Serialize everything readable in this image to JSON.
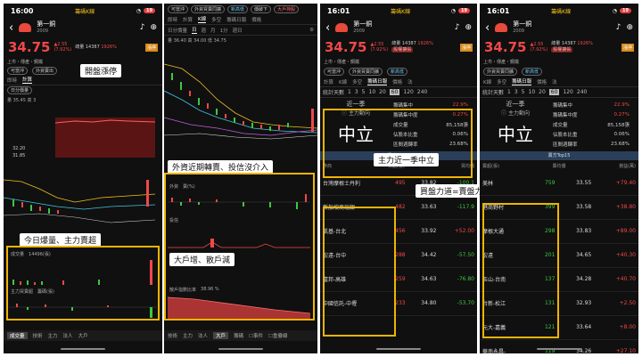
{
  "screen1": {
    "time": "16:00",
    "carrier": "籌碼K線",
    "battery": "19",
    "stock_name": "第一銅",
    "stock_code": "2009",
    "price": "34.75",
    "change": "▲2.55",
    "change_pct": "(7.92%)",
    "volume_text": "總量 14387",
    "vol_pct": "1926%",
    "limit_tag": "漲停",
    "market": "上市・傳產・鋼鐵",
    "tab_labels": [
      "可當沖",
      "外資賣出"
    ],
    "sub_tabs": [
      "即時",
      "計算"
    ],
    "day_label": "日分價量",
    "ma_text": "量 35.45 高 3",
    "price_marks": [
      "32.20",
      "31.85"
    ],
    "vol_legend": "成交量",
    "vol_value": "14496(張)",
    "main_legend": "主力買賣超",
    "main_unit": "籌碼(張)",
    "bottom_tabs": [
      "成交量",
      "技術",
      "主力",
      "法人",
      "大戶"
    ],
    "callout_a": "開盤漲停",
    "callout_b": "今日爆量、主力賣超"
  },
  "screen2": {
    "chips": [
      "可當沖",
      "外資買賣同擴",
      "新高低",
      "價破下",
      "大戶持股"
    ],
    "tabs": [
      "即時",
      "計算",
      "K線",
      "多空",
      "籌碼日報",
      "價格"
    ],
    "chart_header": [
      "日分價量",
      "日",
      "週",
      "月",
      "1分",
      "週日"
    ],
    "ma_line": "量 36.40 高 34.00 低 34.75",
    "legend_1": "外資",
    "legend_1b": "賣(%)",
    "legend_2": "投信",
    "legend_3": "散戶指數比率",
    "legend_3b": "38.96 %",
    "pct_marks": [
      "59.66%",
      "38.96%"
    ],
    "bottom_tabs": [
      "技術",
      "主力",
      "法人",
      "大戶",
      "籌碼"
    ],
    "bottom_on": "大戶",
    "checkbox_a": "事件",
    "checkbox_b": "重疊線",
    "callout_a": "外資近期轉賣、投信沒介入",
    "callout_b": "大戶增、散戶減"
  },
  "screen3": {
    "time": "16:01",
    "carrier": "籌碼K線",
    "battery": "19",
    "stock_name": "第一銅",
    "stock_code": "2009",
    "price": "34.75",
    "change": "▲2.55",
    "change_pct": "(7.92%)",
    "volume_text": "總量 14387",
    "vol_pct": "1926%",
    "tag": "股權擴張",
    "limit_tag": "漲停",
    "market": "上市・傳產・鋼鐵",
    "pills": [
      "可當沖",
      "外資買賣同擴",
      "新高低"
    ],
    "tabs": [
      "計算",
      "K線",
      "多空",
      "籌碼日報",
      "價格",
      "法"
    ],
    "days_label": "統計天數",
    "days": [
      "1",
      "3",
      "5",
      "10",
      "20",
      "60",
      "120",
      "240"
    ],
    "day_on": "60",
    "near_label": "近一季",
    "main_dir": "主力動向",
    "main_value": "中立",
    "metrics": [
      {
        "name": "籌碼集中",
        "value": "22.9%"
      },
      {
        "name": "籌碼集中度",
        "value": "0.27%"
      },
      {
        "name": "成交量",
        "value": "85,158張"
      },
      {
        "name": "佔股本比重",
        "value": "0.06%"
      },
      {
        "name": "區間週轉率",
        "value": "23.68%"
      }
    ],
    "section": "買方Top15",
    "cols": [
      "券商",
      "買超(張)",
      "買均價"
    ],
    "rows": [
      {
        "broker": "台灣摩根士丹利",
        "qty": "495",
        "avg": "33.82",
        "net": "-100.1"
      },
      {
        "broker": "新加坡商瑞銀",
        "qty": "482",
        "avg": "33.63",
        "net": "-117.9"
      },
      {
        "broker": "凱基-台北",
        "qty": "456",
        "avg": "33.92",
        "net": "+52.00"
      },
      {
        "broker": "宏遠-台中",
        "qty": "288",
        "avg": "34.42",
        "net": "-57.50"
      },
      {
        "broker": "富邦-高雄",
        "qty": "259",
        "avg": "34.63",
        "net": "-76.80"
      },
      {
        "broker": "中國信託-中壢",
        "qty": "233",
        "avg": "34.80",
        "net": "-53.70"
      }
    ],
    "callout_a": "主力近一季中立",
    "callout_b": "買盤力道=賣盤力道"
  },
  "screen4": {
    "time": "16:01",
    "carrier": "籌碼K線",
    "battery": "19",
    "stock_name": "第一銅",
    "stock_code": "2009",
    "price": "34.75",
    "change": "▲2.55",
    "change_pct": "(7.92%)",
    "volume_text": "總量 14387",
    "vol_pct": "1926%",
    "tag": "股權擴張",
    "limit_tag": "漲停",
    "market": "上市・傳產・鋼鐵",
    "pills": [
      "外資買賣同擴",
      "新高低"
    ],
    "tabs": [
      "K線",
      "多空",
      "籌碼日報",
      "價格",
      "法"
    ],
    "days_label": "統計天數",
    "days": [
      "1",
      "3",
      "5",
      "10",
      "20",
      "60",
      "120",
      "240"
    ],
    "day_on": "60",
    "near_label": "近一季",
    "main_dir": "主力動向",
    "main_value": "中立",
    "metrics": [
      {
        "name": "籌碼集中",
        "value": "22.9%"
      },
      {
        "name": "籌碼集中度",
        "value": "0.27%"
      },
      {
        "name": "成交量",
        "value": "85,158張"
      },
      {
        "name": "佔股本比重",
        "value": "0.06%"
      },
      {
        "name": "區間週轉率",
        "value": "23.68%"
      }
    ],
    "section": "賣方Top15",
    "cols": [
      "賣超(張)",
      "賣均價",
      "損益(萬)"
    ],
    "rows": [
      {
        "broker": "美林",
        "qty": "759",
        "avg": "33.55",
        "net": "+79.40"
      },
      {
        "broker": "港商野村",
        "qty": "399",
        "avg": "33.58",
        "net": "+38.80"
      },
      {
        "broker": "摩根大通",
        "qty": "298",
        "avg": "33.83",
        "net": "+89.00"
      },
      {
        "broker": "宏遠",
        "qty": "201",
        "avg": "34.65",
        "net": "+40.30"
      },
      {
        "broker": "玉山-台南",
        "qty": "137",
        "avg": "34.28",
        "net": "+40.70"
      },
      {
        "broker": "台新-松江",
        "qty": "131",
        "avg": "32.93",
        "net": "+2.50"
      },
      {
        "broker": "元大-嘉義",
        "qty": "121",
        "avg": "33.64",
        "net": "+8.00"
      },
      {
        "broker": "華南永昌-",
        "qty": "119",
        "avg": "34.26",
        "net": "+27.10"
      }
    ]
  }
}
